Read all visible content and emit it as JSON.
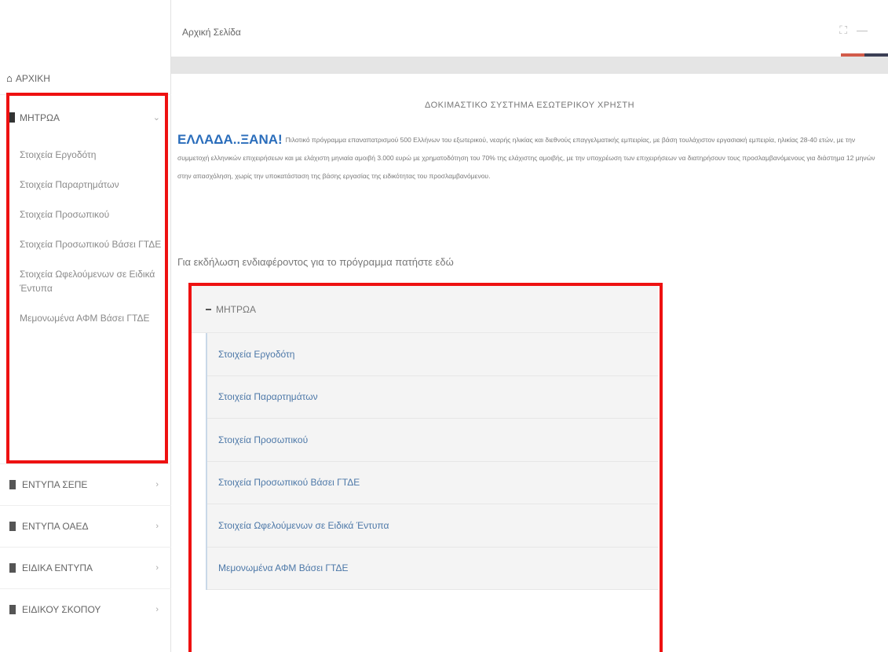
{
  "sidebar": {
    "home_label": "ΑΡΧΙΚΗ",
    "registry": {
      "label": "ΜΗΤΡΩΑ",
      "items": [
        "Στοιχεία Εργοδότη",
        "Στοιχεία Παραρτημάτων",
        "Στοιχεία Προσωπικού",
        "Στοιχεία Προσωπικού Βάσει ΓΤΔΕ",
        "Στοιχεία Ωφελούμενων σε Ειδικά Έντυπα",
        "Μεμονωμένα ΑΦΜ Βάσει ΓΤΔΕ"
      ]
    },
    "lower_items": [
      "ΕΝΤΥΠΑ ΣΕΠΕ",
      "ΕΝΤΥΠΑ ΟΑΕΔ",
      "ΕΙΔΙΚΑ ΕΝΤΥΠΑ",
      "ΕΙΔΙΚΟΥ ΣΚΟΠΟΥ"
    ]
  },
  "header": {
    "breadcrumb": "Αρχική Σελίδα"
  },
  "main": {
    "system_title": "ΔΟΚΙΜΑΣΤΙΚΟ ΣΥΣΤΗΜΑ ΕΣΩΤΕΡΙΚΟΥ ΧΡΗΣΤΗ",
    "brand": "ΕΛΛΑΔΑ..ΞΑΝΑ!",
    "intro_text": "Πιλοτικό πρόγραμμα επαναπατρισμού 500 Ελλήνων του εξωτερικού, νεαρής ηλικίας και διεθνούς επαγγελματικής εμπειρίας, με βάση τουλάχιστον εργασιακή εμπειρία, ηλικίας 28-40 ετών, με την συμμετοχή ελληνικών επιχειρήσεων και με ελάχιστη μηνιαία αμοιβή 3.000 ευρώ με χρηματοδότηση του 70% της ελάχιστης αμοιβής, με την υποχρέωση των επιχειρήσεων να διατηρήσουν τους προσλαμβανόμενους για διάστημα 12 μηνών στην απασχόληση, χωρίς την υποκατάσταση της βάσης εργασίας της ειδικότητας του προσλαμβανόμενου.",
    "interest_text": "Για εκδήλωση ενδιαφέροντος για το πρόγραμμα πατήστε εδώ",
    "panel": {
      "title": "ΜΗΤΡΩΑ",
      "items": [
        "Στοιχεία Εργοδότη",
        "Στοιχεία Παραρτημάτων",
        "Στοιχεία Προσωπικού",
        "Στοιχεία Προσωπικού Βάσει ΓΤΔΕ",
        "Στοιχεία Ωφελούμενων σε Ειδικά Έντυπα",
        "Μεμονωμένα ΑΦΜ Βάσει ΓΤΔΕ"
      ]
    }
  }
}
